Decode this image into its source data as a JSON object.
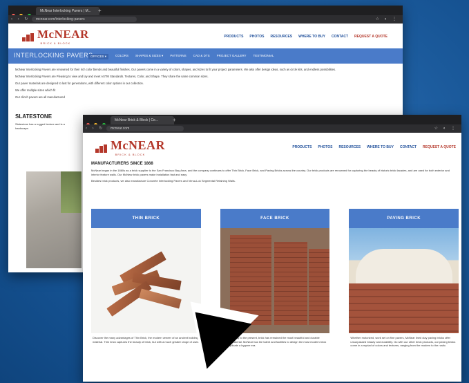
{
  "colors": {
    "brand_red": "#b4372a",
    "nav_blue": "#1f4f9a",
    "bar_blue": "#4a7bc9",
    "background": "#1a5ca3"
  },
  "window_back": {
    "tab_title": "McNear Interlocking Pavers | M...",
    "url": "mcnear.com/interlocking-pavers",
    "logo_text": "McNEAR",
    "logo_sub": "BRICK & BLOCK",
    "nav": [
      "PRODUCTS",
      "PHOTOS",
      "RESOURCES",
      "WHERE TO BUY",
      "CONTACT"
    ],
    "quote": "REQUEST A QUOTE",
    "page_title": "INTERLOCKING PAVERS",
    "subnav": [
      "OFFICES ▾",
      "COLORS",
      "SHAPES & SIZES ▾",
      "PATTERNS",
      "CAD & DTS",
      "PROJECT GALLERY",
      "TESTIMONIAL"
    ],
    "paragraphs": [
      "McNear Interlocking Pavers are renowned for their rich color blends and beautiful finishes. Our pavers come in a variety of colors, shapes, and sizes to fit your project parameters. We also offer design ideas, such as circle kits, and endless possibilities.",
      "McNear Interlocking Pavers are Pleasing to view and lay and meet ASTM Standards. Textures, Color, and Shape. They share the same common sizes.",
      "Our paver materials are designed to last for generations, with different color options in our collection.",
      "We offer multiple sizes which fit",
      "Our clinch pavers are all manufactured"
    ],
    "section_heading": "SLATESTONE",
    "section_text": "Slatestone has a rugged texture and is a hardscape."
  },
  "window_front": {
    "tab_title": "McNear Brick & Block | Ce...",
    "url": "mcnear.com",
    "logo_text": "McNEAR",
    "logo_sub": "BRICK & BLOCK",
    "nav": [
      "PRODUCTS",
      "PHOTOS",
      "RESOURCES",
      "WHERE TO BUY",
      "CONTACT"
    ],
    "quote": "REQUEST A QUOTE",
    "heading": "MANUFACTURERS SINCE 1868",
    "paragraphs": [
      "McNear began in the 1860s as a brick supplier to the San Francisco Bay Area, and the company continues to offer Thin Brick, Face Brick, and Paving Bricks across the country. Our brick products are renowned for capturing the beauty of historic brick facades, and are used for both exterior and interior feature walls. Our McNear brick pavers make installation fast and easy.",
      "Besides brick products, we also manufacture Concrete Interlocking Pavers and Versa-Lok Segmental Retaining Walls."
    ],
    "cards": [
      {
        "title": "THIN BRICK",
        "text": "Discover the many advantages of Thin Brick, the modern veneer of an ancient building material. Thin brick captures the beauty of brick, but with a much greater range of uses."
      },
      {
        "title": "FACE BRICK",
        "text": "From Antiquity to the present, brick has remained the most beautiful and durable building material. McNear has the talent and facilities to design the most modern brick or to replicate a bygone era."
      },
      {
        "title": "PAVING BRICK",
        "text": "Whether motorized, work set on fine pavers, McNear lined clay paving bricks offer unsurpassed beauty and durability. Go with our other brick products, our paving bricks come in a myriad of colors and textures, ranging from the modern to the rustic."
      }
    ]
  }
}
